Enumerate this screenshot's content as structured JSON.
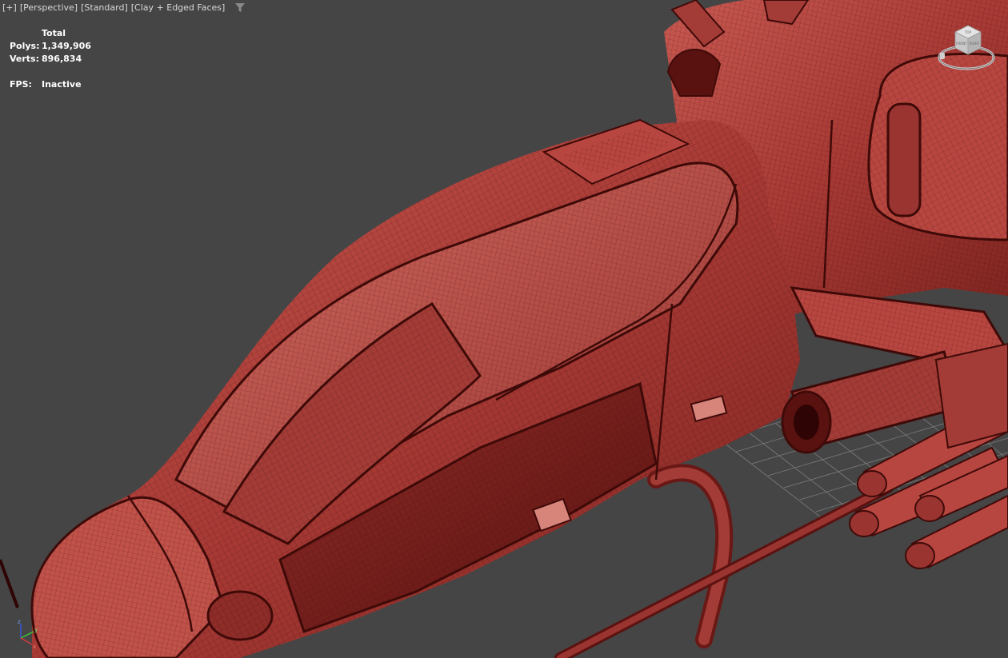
{
  "viewport": {
    "labels": [
      "[+]",
      "[Perspective]",
      "[Standard]",
      "[Clay + Edged Faces]"
    ],
    "filter_icon": "funnel-icon"
  },
  "stats": {
    "header": "Total",
    "polys_label": "Polys:",
    "polys_value": "1,349,906",
    "verts_label": "Verts:",
    "verts_value": "896,834",
    "fps_label": "FPS:",
    "fps_value": "Inactive"
  },
  "viewcube": {
    "icon": "viewcube-icon",
    "faces": [
      "TOP",
      "RIGHT",
      "FRONT"
    ]
  },
  "axis": {
    "x": "x",
    "y": "y",
    "z": "z"
  },
  "colors": {
    "background": "#454545",
    "model_fill": "#b2413c",
    "model_dark": "#4a0d0b",
    "grid": "#9a9a9a"
  }
}
